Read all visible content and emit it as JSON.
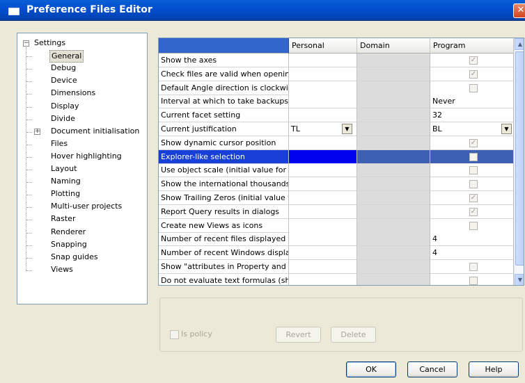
{
  "window": {
    "title": "Preference Files Editor",
    "close_glyph": "✕"
  },
  "tree": {
    "root": {
      "label": "Settings",
      "expander": "−"
    },
    "items": [
      {
        "label": "General",
        "selected": true
      },
      {
        "label": "Debug"
      },
      {
        "label": "Device"
      },
      {
        "label": "Dimensions"
      },
      {
        "label": "Display"
      },
      {
        "label": "Divide"
      },
      {
        "label": "Document initialisation",
        "expander": "+"
      },
      {
        "label": "Files"
      },
      {
        "label": "Hover highlighting"
      },
      {
        "label": "Layout"
      },
      {
        "label": "Naming"
      },
      {
        "label": "Plotting"
      },
      {
        "label": "Multi-user projects"
      },
      {
        "label": "Raster"
      },
      {
        "label": "Renderer"
      },
      {
        "label": "Snapping"
      },
      {
        "label": "Snap guides"
      },
      {
        "label": "Views"
      }
    ]
  },
  "grid": {
    "columns": [
      "Personal",
      "Domain",
      "Program"
    ],
    "rows": [
      {
        "name": "Show the axes",
        "personal": "",
        "program": "",
        "program_check": true
      },
      {
        "name": "Check files are valid when opening",
        "personal": "",
        "program": "",
        "program_check": true
      },
      {
        "name": "Default Angle direction is clockwise",
        "personal": "",
        "program": "",
        "program_check": false
      },
      {
        "name": "Interval at which to take backups",
        "personal": "",
        "program": "Never"
      },
      {
        "name": "Current facet setting",
        "personal": "",
        "program": "32"
      },
      {
        "name": "Current justification",
        "personal": "TL",
        "program": "BL",
        "dropdown": true
      },
      {
        "name": "Show dynamic cursor position",
        "personal": "",
        "program": "",
        "program_check": true
      },
      {
        "name": "Explorer-like selection",
        "personal": "",
        "program": "",
        "program_check": false,
        "selected": true
      },
      {
        "name": "Use object scale (initial value for n",
        "personal": "",
        "program": "",
        "program_check": false
      },
      {
        "name": "Show the international thousands",
        "personal": "",
        "program": "",
        "program_check": false
      },
      {
        "name": "Show Trailing Zeros (initial value fc",
        "personal": "",
        "program": "",
        "program_check": true
      },
      {
        "name": "Report Query results in dialogs",
        "personal": "",
        "program": "",
        "program_check": true
      },
      {
        "name": "Create new Views as icons",
        "personal": "",
        "program": "",
        "program_check": false
      },
      {
        "name": "Number of recent files displayed",
        "personal": "",
        "program": "4"
      },
      {
        "name": "Number of recent Windows display",
        "personal": "",
        "program": "4"
      },
      {
        "name": "Show \"attributes in Property and (",
        "personal": "",
        "program": "",
        "program_check": false
      },
      {
        "name": "Do not evaluate text formulas (sh",
        "personal": "",
        "program": "",
        "program_check": false
      }
    ],
    "scroll_up": "▲",
    "scroll_down": "▼",
    "dropdown_glyph": "▼",
    "check_glyph": "✓"
  },
  "policy": {
    "label": "Is policy",
    "checked": false
  },
  "buttons": {
    "revert": "Revert",
    "delete": "Delete",
    "ok": "OK",
    "cancel": "Cancel",
    "help": "Help"
  }
}
